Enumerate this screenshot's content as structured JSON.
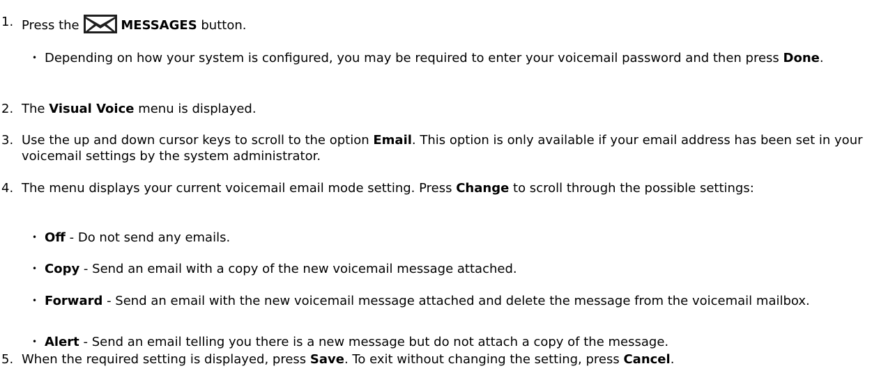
{
  "steps": [
    {
      "number": "1.",
      "pre": "Press the ",
      "icon": "envelope-icon",
      "bold": "MESSAGES",
      "post": " button."
    },
    {
      "number": "2.",
      "pre": "The ",
      "bold": "Visual Voice",
      "post": " menu is displayed."
    },
    {
      "number": "3.",
      "pre": "Use the up and down cursor keys to scroll to the option ",
      "bold": "Email",
      "post": ". This option is only available if your email address has been set in your voicemail settings by the system administrator."
    },
    {
      "number": "4.",
      "pre": "The menu displays your current voicemail email mode setting. Press ",
      "bold": "Change",
      "post": " to scroll through the possible settings:"
    },
    {
      "number": "5.",
      "pre": "When the required setting is displayed, press ",
      "bold": "Save",
      "mid": ". To exit without changing the setting, press ",
      "bold2": "Cancel",
      "post": "."
    }
  ],
  "step1_note": {
    "bullet": "•",
    "pre": "Depending on how your system is configured, you may be required to enter your voicemail password and then press ",
    "bold": "Done",
    "post": "."
  },
  "modes": [
    {
      "bullet": "•",
      "name": "Off",
      "desc": " - Do not send any emails."
    },
    {
      "bullet": "•",
      "name": "Copy",
      "desc": " - Send an email with a copy of the new voicemail message attached."
    },
    {
      "bullet": "•",
      "name": "Forward",
      "desc": " - Send an email with the new voicemail message attached and delete the message from the voicemail mailbox."
    },
    {
      "bullet": "•",
      "name": "Alert",
      "desc": " - Send an email telling you there is a new message but do not attach a copy of the message."
    }
  ]
}
